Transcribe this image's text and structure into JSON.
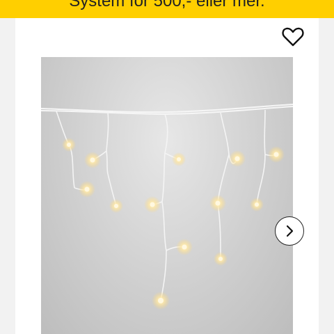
{
  "promo_banner": {
    "text": "System för 500,- eller mer."
  },
  "product": {
    "favourite_icon": "heart-outline-icon",
    "image_subject": "icicle-light-string",
    "carousel_next_icon": "chevron-right-icon"
  },
  "colors": {
    "banner": "#ffcf00",
    "card": "#ffffff",
    "page_background": "#f2f2f2"
  }
}
